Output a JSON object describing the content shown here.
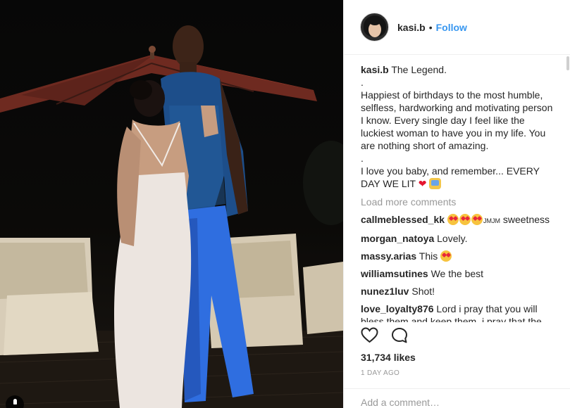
{
  "post": {
    "username": "kasi.b",
    "dot": "•",
    "follow_label": "Follow",
    "caption": {
      "username": "kasi.b",
      "text": "The Legend.\n.\nHappiest of birthdays to the most humble, selfless, hardworking and motivating person I know. Every single day I feel like the luckiest woman to have you in my life. You are nothing short of amazing.\n.\nI love you baby, and remember... EVERY DAY WE LIT",
      "heart_emoji": "❤"
    },
    "load_more_label": "Load more comments",
    "comments": [
      {
        "username": "callmeblessed_kk",
        "prefix": "",
        "small": "JMJM",
        "text": " sweetness"
      },
      {
        "username": "morgan_natoya",
        "text": "Lovely."
      },
      {
        "username": "massy.arias",
        "text": "This"
      },
      {
        "username": "williamsutines",
        "text": "We the best"
      },
      {
        "username": "nunez1luv",
        "text": "Shot!"
      },
      {
        "username": "love_loyalty876",
        "text": "Lord i pray that you will bless them and keep them, i pray that the"
      }
    ],
    "icons": {
      "like": "heart-outline-icon",
      "comment": "speech-bubble-icon",
      "profile": "user-icon"
    },
    "likes": "31,734 likes",
    "time": "1 DAY AGO",
    "add_comment_placeholder": "Add a comment…"
  },
  "colors": {
    "link": "#3897f0",
    "muted": "#999999",
    "text": "#262626",
    "border": "#efefef"
  }
}
